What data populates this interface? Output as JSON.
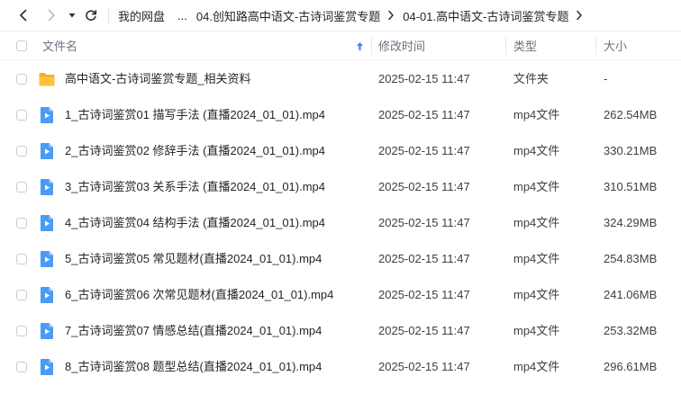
{
  "breadcrumb": {
    "root": "我的网盘",
    "ellipsis": "...",
    "items": [
      "04.创知路高中语文-古诗词鉴赏专题",
      "04-01.高中语文-古诗词鉴赏专题"
    ]
  },
  "columns": {
    "name": "文件名",
    "modified": "修改时间",
    "type": "类型",
    "size": "大小"
  },
  "files": [
    {
      "icon": "folder-icon",
      "name": "高中语文-古诗词鉴赏专题_相关资料",
      "modified": "2025-02-15 11:47",
      "type": "文件夹",
      "size": "-"
    },
    {
      "icon": "video-file-icon",
      "name": "1_古诗词鉴赏01 描写手法 (直播2024_01_01).mp4",
      "modified": "2025-02-15 11:47",
      "type": "mp4文件",
      "size": "262.54MB"
    },
    {
      "icon": "video-file-icon",
      "name": "2_古诗词鉴赏02 修辞手法 (直播2024_01_01).mp4",
      "modified": "2025-02-15 11:47",
      "type": "mp4文件",
      "size": "330.21MB"
    },
    {
      "icon": "video-file-icon",
      "name": "3_古诗词鉴赏03 关系手法 (直播2024_01_01).mp4",
      "modified": "2025-02-15 11:47",
      "type": "mp4文件",
      "size": "310.51MB"
    },
    {
      "icon": "video-file-icon",
      "name": "4_古诗词鉴赏04 结构手法 (直播2024_01_01).mp4",
      "modified": "2025-02-15 11:47",
      "type": "mp4文件",
      "size": "324.29MB"
    },
    {
      "icon": "video-file-icon",
      "name": "5_古诗词鉴赏05 常见题材(直播2024_01_01).mp4",
      "modified": "2025-02-15 11:47",
      "type": "mp4文件",
      "size": "254.83MB"
    },
    {
      "icon": "video-file-icon",
      "name": "6_古诗词鉴赏06 次常见题材(直播2024_01_01).mp4",
      "modified": "2025-02-15 11:47",
      "type": "mp4文件",
      "size": "241.06MB"
    },
    {
      "icon": "video-file-icon",
      "name": "7_古诗词鉴赏07 情感总结(直播2024_01_01).mp4",
      "modified": "2025-02-15 11:47",
      "type": "mp4文件",
      "size": "253.32MB"
    },
    {
      "icon": "video-file-icon",
      "name": "8_古诗词鉴赏08 题型总结(直播2024_01_01).mp4",
      "modified": "2025-02-15 11:47",
      "type": "mp4文件",
      "size": "296.61MB"
    }
  ],
  "colors": {
    "accent": "#3b82f6",
    "folder": "#fbbf24",
    "video": "#4a9bf2"
  }
}
